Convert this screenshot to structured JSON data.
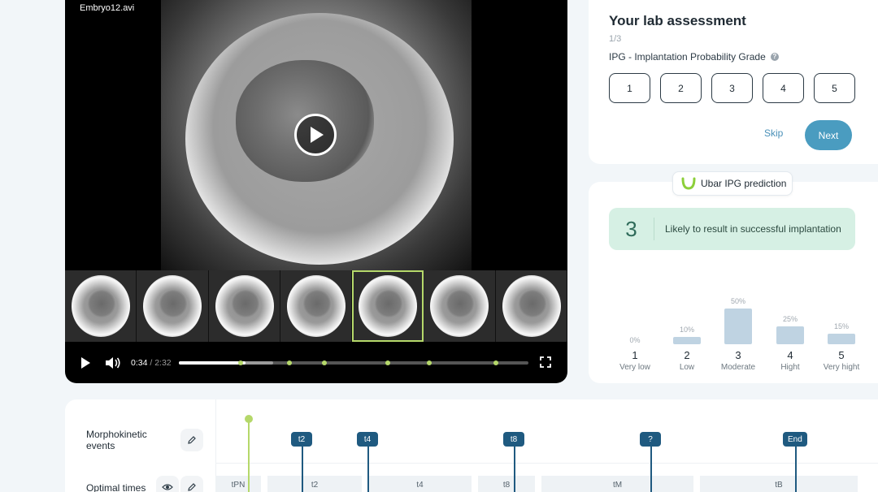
{
  "player": {
    "filename": "Embryo12.avi",
    "current_time": "0:34",
    "separator": " / ",
    "duration": "2:32",
    "progress_fraction": 0.19,
    "buffer_fraction": 0.27,
    "thumbnail_count": 7,
    "selected_thumbnail": 4
  },
  "assessment": {
    "title": "Your lab assessment",
    "step": "1/3",
    "grade_label": "IPG - Implantation Probability Grade",
    "grades": [
      "1",
      "2",
      "3",
      "4",
      "5"
    ],
    "skip_label": "Skip",
    "next_label": "Next"
  },
  "prediction": {
    "badge_label": "Ubar IPG prediction",
    "result_grade": "3",
    "result_text": "Likely to result in successful implantation",
    "distribution": [
      {
        "grade": "1",
        "label": "Very low",
        "percent_text": "0%",
        "value": 0
      },
      {
        "grade": "2",
        "label": "Low",
        "percent_text": "10%",
        "value": 10
      },
      {
        "grade": "3",
        "label": "Moderate",
        "percent_text": "50%",
        "value": 50
      },
      {
        "grade": "4",
        "label": "Hight",
        "percent_text": "25%",
        "value": 25
      },
      {
        "grade": "5",
        "label": "Very hight",
        "percent_text": "15%",
        "value": 15
      }
    ]
  },
  "timeline": {
    "events_label": "Morphokinetic events",
    "optimal_label": "Optimal times",
    "markers": [
      "t2",
      "t4",
      "t8",
      "?",
      "End"
    ],
    "segments": [
      "tPN",
      "t2",
      "t4",
      "t8",
      "tM",
      "tB"
    ]
  },
  "colors": {
    "accent_green": "#b5d86a",
    "primary_blue": "#4a9cc0",
    "marker_blue": "#1f5a80",
    "prediction_bg": "#d6f0e4"
  }
}
